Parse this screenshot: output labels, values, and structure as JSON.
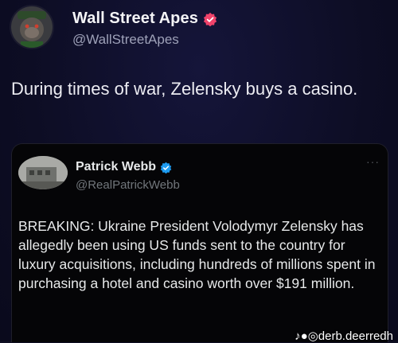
{
  "author": {
    "display_name": "Wall Street Apes",
    "handle": "@WallStreetApes",
    "avatar_icon": "gorilla-avatar-icon",
    "badge_color": "#f0436b"
  },
  "tweet": {
    "text": "During times of war, Zelensky buys a casino."
  },
  "quoted": {
    "display_name": "Patrick Webb",
    "handle": "@RealPatrickWebb",
    "more_icon": "ellipsis-icon",
    "more_label": "···",
    "badge_color": "#1d9bf0",
    "text": "BREAKING: Ukraine President Volodymyr Zelensky has allegedly been using US funds sent to the country for luxury acquisitions, including hundreds of millions spent in purchasing a hotel and casino worth over $191 million."
  },
  "watermark": {
    "text": "♪●◎derb.deerredh"
  }
}
